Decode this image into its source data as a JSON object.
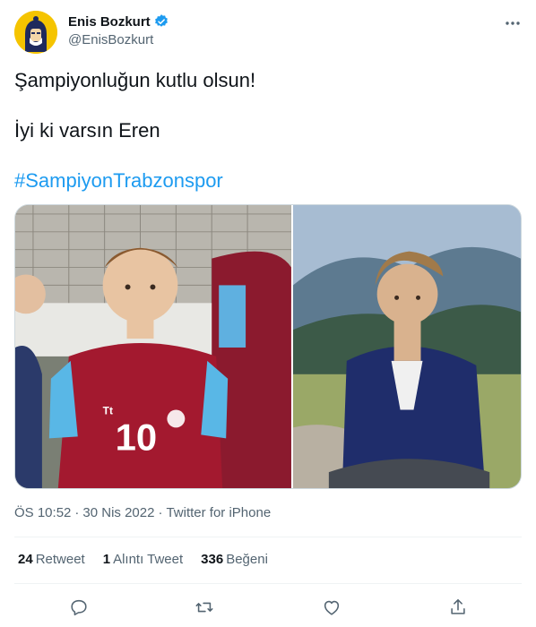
{
  "author": {
    "display_name": "Enis Bozkurt",
    "handle": "@EnisBozkurt",
    "verified": true,
    "avatar_icon": "avatar-character-icon"
  },
  "tweet": {
    "line1": "Şampiyonluğun kutlu olsun!",
    "line2": "İyi ki varsın Eren",
    "hashtag": "#SampiyonTrabzonspor"
  },
  "media": {
    "left_photo_jersey_number": "10",
    "left_photo_jersey_brand": "Tt"
  },
  "meta": {
    "time": "ÖS 10:52",
    "dot1": "·",
    "date": "30 Nis 2022",
    "dot2": "·",
    "source": "Twitter for iPhone"
  },
  "stats": {
    "retweets_count": "24",
    "retweets_label": "Retweet",
    "quotes_count": "1",
    "quotes_label": "Alıntı Tweet",
    "likes_count": "336",
    "likes_label": "Beğeni"
  },
  "actions": [
    "reply-icon",
    "retweet-icon",
    "like-icon",
    "share-icon"
  ],
  "colors": {
    "link": "#1d9bf0",
    "secondary_text": "#536471",
    "primary_text": "#0f1419",
    "divider": "#eff3f4",
    "avatar_bg": "#f5c400"
  }
}
